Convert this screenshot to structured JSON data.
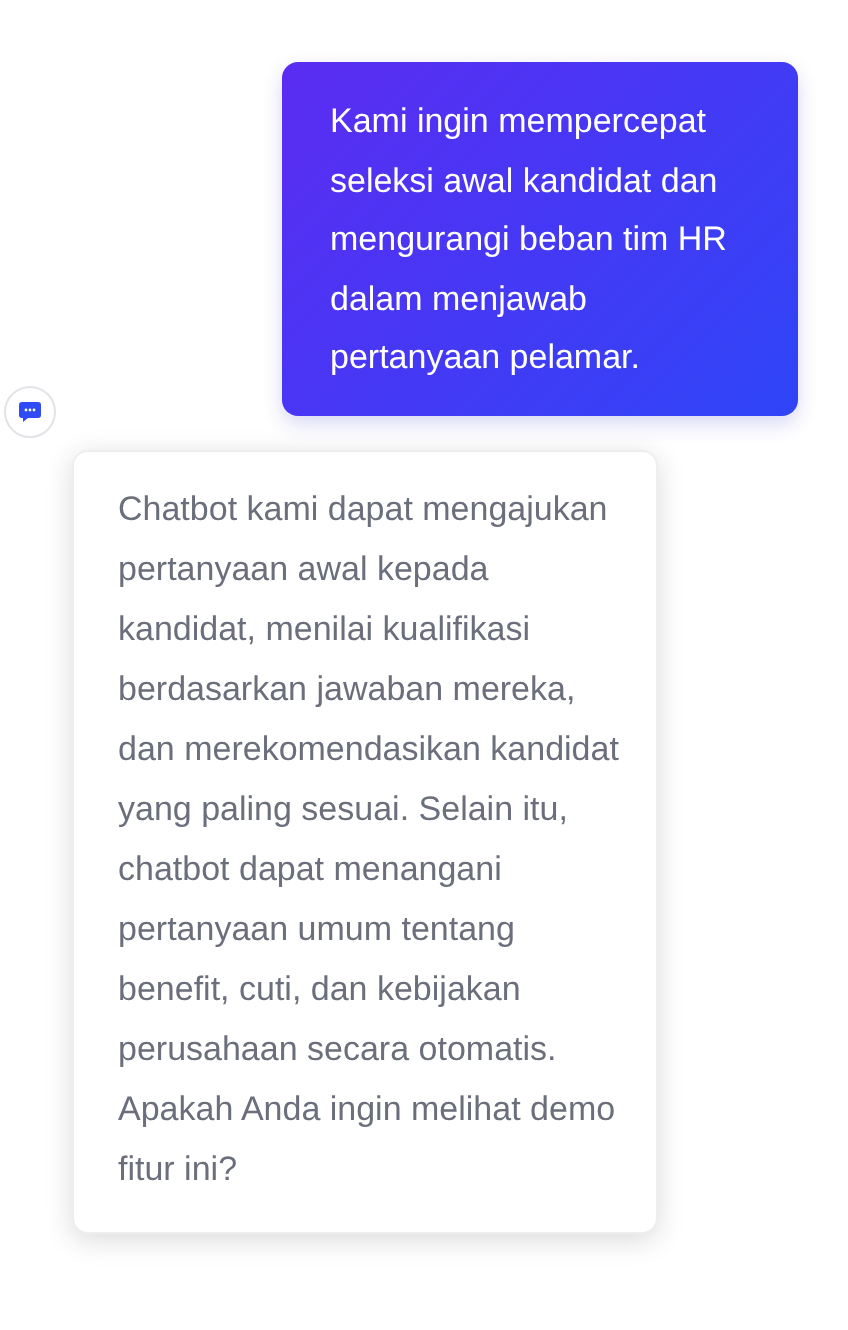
{
  "messages": [
    {
      "kind": "user",
      "text": "Kami ingin mempercepat seleksi awal kandidat dan mengurangi beban tim HR dalam menjawab pertanyaan pelamar."
    },
    {
      "kind": "bot",
      "text": "Chatbot kami dapat mengajukan pertanyaan awal kepada kandidat, menilai kualifikasi berdasarkan jawaban mereka, dan merekomendasikan kandidat yang paling sesuai. Selain itu, chatbot dapat menangani pertanyaan umum tentang benefit, cuti, dan kebijakan perusahaan secara otomatis. Apakah Anda ingin melihat demo fitur ini?"
    }
  ]
}
